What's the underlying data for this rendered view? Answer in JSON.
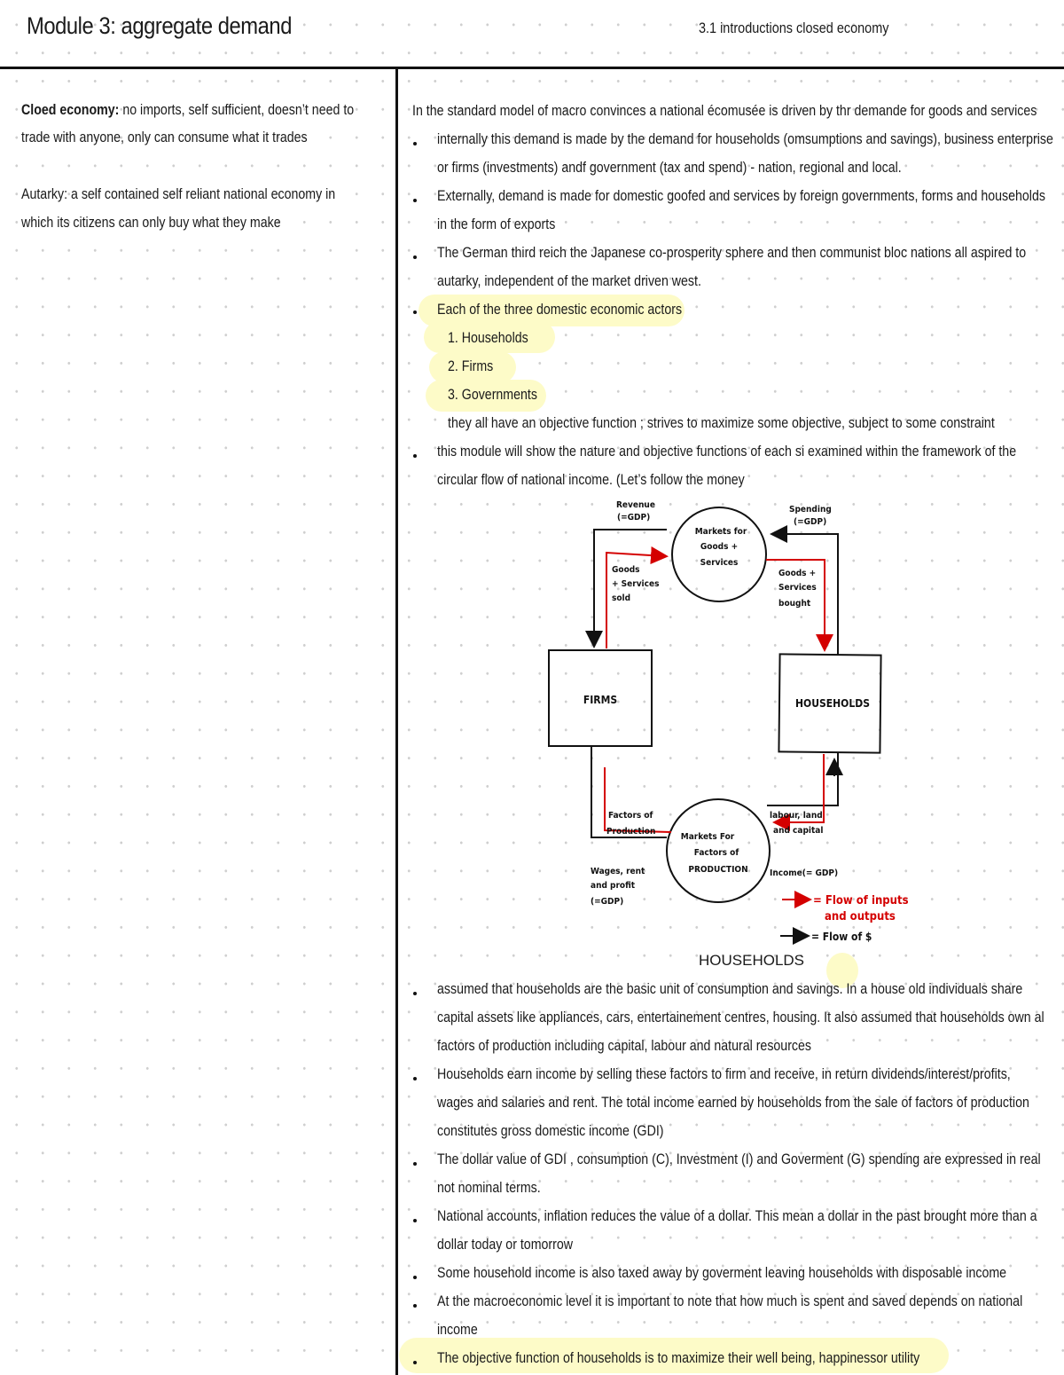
{
  "header": {
    "title": "Module 3: aggregate demand",
    "subtitle": "3.1 introductions closed economy"
  },
  "left_column": {
    "definitions": [
      {
        "term": "Cloed economy:",
        "lines": [
          " no imports, self sufficient, doesn’t need to",
          "trade with anyone, only can consume what it trades"
        ]
      },
      {
        "lines": [
          "Autarky: a self contained self reliant national economy in",
          "which its citizens can only buy what they make"
        ]
      }
    ]
  },
  "main": {
    "intro": "In the standard model of macro convinces a national écomusée is driven by thr demande for goods and services",
    "bullets_top": [
      [
        "internally this demand is made by the demand for households (omsumptions and savings), business enterprise",
        "or firms (investments) andf government (tax and spend) - nation, regional and local."
      ],
      [
        "Externally, demand is made for domestic goofed and services by foreign governments, forms and households",
        "in the form of exports"
      ],
      [
        "The German third reich the Japanese co-prosperity sphere and then communist bloc nations all aspired to",
        "autarky, independent of the market driven west."
      ],
      [
        "Each of the three domestic economic actors"
      ]
    ],
    "actors": [
      "1. Households",
      "2. Firms",
      "3. Governments"
    ],
    "objective_note": "they all have an objective function ; strives to maximize some objective, subject to some constraint",
    "bullet_module": [
      "this module will show the nature and objective functions of each si examined within the framework of the",
      "circular flow of national income.  (Let’s follow the money"
    ],
    "diagram": {
      "goods_market": [
        "Markets for",
        "Goods +",
        "Services"
      ],
      "factor_market": [
        "Markets For",
        "Factors of",
        "PRODUCTION"
      ],
      "firms": "FIRMS",
      "households": "HOUSEHOLDS",
      "revenue": [
        "Revenue",
        "(=GDP)"
      ],
      "spending": [
        "Spending",
        "(=GDP)"
      ],
      "goods_sold": [
        "Goods",
        "+ Services",
        "sold"
      ],
      "goods_bought": [
        "Goods +",
        "Services",
        "bought"
      ],
      "factors_of_production": [
        "Factors of",
        "Production"
      ],
      "labour_land_capital": [
        "labour, land",
        "and capital"
      ],
      "wages": [
        "Wages, rent",
        "and profit",
        "(=GDP)"
      ],
      "income": "Income(= GDP)",
      "legend": {
        "red": [
          "= Flow of inputs",
          "and outputs"
        ],
        "black": "= Flow of $"
      },
      "colors": {
        "red": "#d40000",
        "black": "#111111"
      }
    },
    "section_heading": "HOUSEHOLDS",
    "bullets_bottom": [
      [
        "assumed that households are the basic unit of consumption and savings. In a house old individuals share",
        "capital assets like appliances, cars, entertainement centres, housing. It also assumed that households own al",
        "factors of production including capital, labour and natural resources"
      ],
      [
        "Households earn income by selling these factors to firm and receive, in return dividends/interest/profits,",
        "wages and salaries and rent. The total income earned by households from the sale of factors of production",
        "constitutes gross domestic income (GDI)"
      ],
      [
        "The dollar value of GDI , consumption (C), Investment (I) and Goverment (G) spending are expressed in real",
        "not nominal terms."
      ],
      [
        "National accounts, inflation reduces the value of a dollar. This mean a dollar in the past brought more than a",
        "dollar today or tomorrow"
      ],
      [
        "Some household income is also taxed away by goverment leaving households with disposable income"
      ],
      [
        "At the macroeconomic level it is important to note that how much is spent and saved depends on national",
        "income"
      ],
      [
        "The objective function of households is to maximize their well being, happinessor utility"
      ]
    ]
  },
  "highlight_color": "#fdfbc8"
}
